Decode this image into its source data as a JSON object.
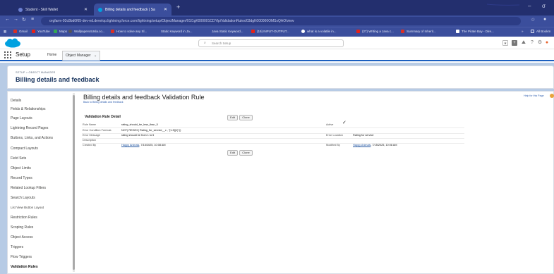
{
  "browser": {
    "tabs": [
      {
        "label": "Student - Skill Wallet",
        "color": "#6b7fd1"
      },
      {
        "label": "Billing details and feedback | Sa",
        "color": "#00a1e0"
      }
    ],
    "new_tab": "+",
    "window_controls": [
      "–",
      "σ"
    ],
    "url": "orgfarm-93c8bd0f65-dev-ed.develop.lightning.force.com/lightning/setup/ObjectManager/01I1gK000001CDYlp/ValidationRules/03dgK000000OMSxQAO/view",
    "bookmarks": [
      {
        "label": "Gmail",
        "color": "#d93025"
      },
      {
        "label": "YouTube",
        "color": "#e62117"
      },
      {
        "label": "Maps",
        "color": "#34a853"
      },
      {
        "label": "Wallpapers4Usla.co...",
        "color": "#555555"
      },
      {
        "label": "How to solve any Sl...",
        "color": "#d93025"
      },
      {
        "label": "Static Keyword in Ja...",
        "color": "#3b4e9c"
      },
      {
        "label": "Java Static Keyword...",
        "color": "#3b4e9c"
      },
      {
        "label": "(19) INPUT-OUTPUT...",
        "color": "#e62117"
      },
      {
        "label": "what is a volatile in...",
        "color": "#ffffff"
      },
      {
        "label": "(27) Writing a Java c...",
        "color": "#e62117"
      },
      {
        "label": "Summary of Inherit...",
        "color": "#d93025"
      },
      {
        "label": "The Pirate Bay - Dire...",
        "color": "#ffffff"
      },
      {
        "label": "»",
        "color": ""
      },
      {
        "label": "All Bookm",
        "color": ""
      }
    ]
  },
  "header": {
    "search_placeholder": "Search Setup",
    "app_name": "Setup",
    "nav_home": "Home",
    "nav_object_manager": "Object Manager"
  },
  "object": {
    "breadcrumb": "SETUP > OBJECT MANAGER",
    "title": "Billing details and feedback"
  },
  "sidebar": {
    "items": [
      "Details",
      "Fields & Relationships",
      "Page Layouts",
      "Lightning Record Pages",
      "Buttons, Links, and Actions",
      "Compact Layouts",
      "Field Sets",
      "Object Limits",
      "Record Types",
      "Related Lookup Filters",
      "Search Layouts",
      "List View Button Layout",
      "Restriction Rules",
      "Scoping Rules",
      "Object Access",
      "Triggers",
      "Flow Triggers",
      "Validation Rules"
    ],
    "selected_index": 17
  },
  "main": {
    "title": "Billing details and feedback Validation Rule",
    "back_link": "Back to Billing details and feedback",
    "help_link": "Help for this Page",
    "detail_heading": "Validation Rule Detail",
    "edit_label": "Edit",
    "clone_label": "Clone",
    "fields": {
      "rule_name_label": "Rule Name",
      "rule_name_value": "rating_should_be_less_than_5",
      "active_label": "Active",
      "formula_label": "Error Condition Formula",
      "formula_value": "NOT( REGEX( Rating_for_service__c , \"[1-5]{1}\"))",
      "message_label": "Error Message",
      "message_value": "rating should be from 1 to 5",
      "location_label": "Error Location",
      "location_value": "Rating for service",
      "description_label": "Description",
      "description_value": "",
      "created_label": "Created By",
      "created_user": "Happy Animals",
      "created_date": ", 7/15/2025, 10:08 AM",
      "modified_label": "Modified By",
      "modified_user": "Happy Animals",
      "modified_date": ", 7/15/2025, 10:08 AM"
    }
  }
}
